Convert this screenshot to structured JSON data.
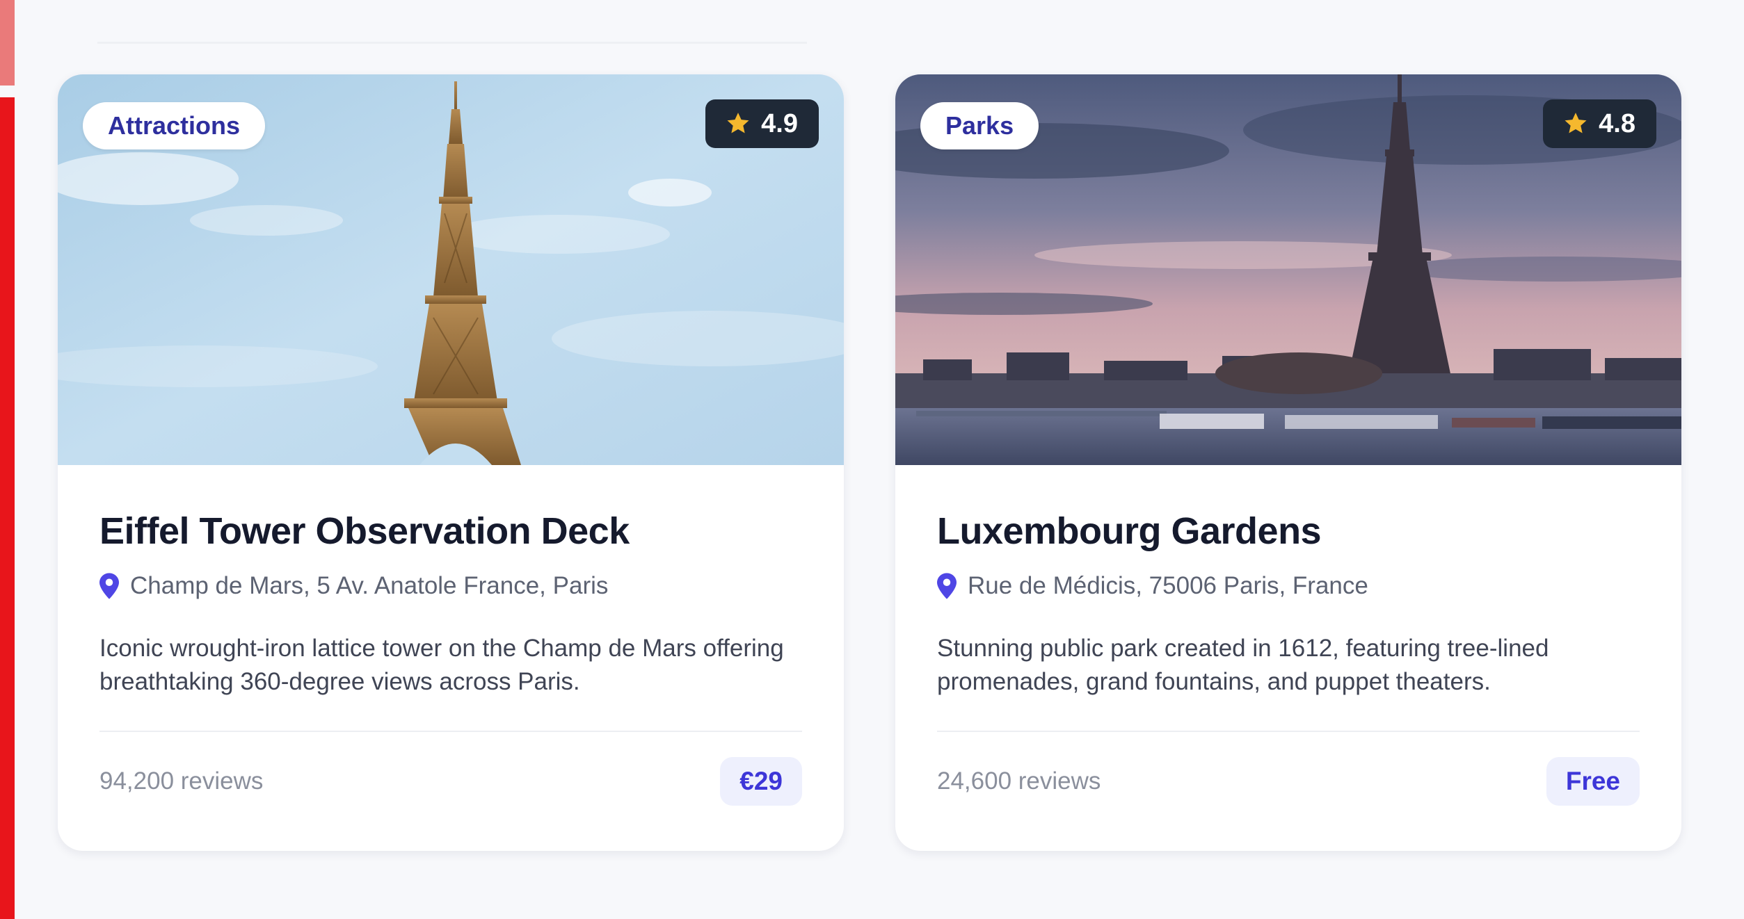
{
  "colors": {
    "accent_red": "#e8151b",
    "brand_indigo": "#3d36d8",
    "pill_text": "#2e2f9e",
    "badge_bg": "#1f2937",
    "star": "#f5b82e"
  },
  "cards": [
    {
      "category": "Attractions",
      "rating": "4.9",
      "title": "Eiffel Tower Observation Deck",
      "address": "Champ de Mars, 5 Av. Anatole France, Paris",
      "description": "Iconic wrought-iron lattice tower on the Champ de Mars offering breathtaking 360-degree views across Paris.",
      "reviews": "94,200 reviews",
      "price": "€29",
      "image_icon": "eiffel-tower-day-photo"
    },
    {
      "category": "Parks",
      "rating": "4.8",
      "title": "Luxembourg Gardens",
      "address": "Rue de Médicis, 75006 Paris, France",
      "description": "Stunning public park created in 1612, featuring tree-lined promenades, grand fountains, and puppet theaters.",
      "reviews": "24,600 reviews",
      "price": "Free",
      "image_icon": "eiffel-tower-sunset-photo"
    }
  ]
}
